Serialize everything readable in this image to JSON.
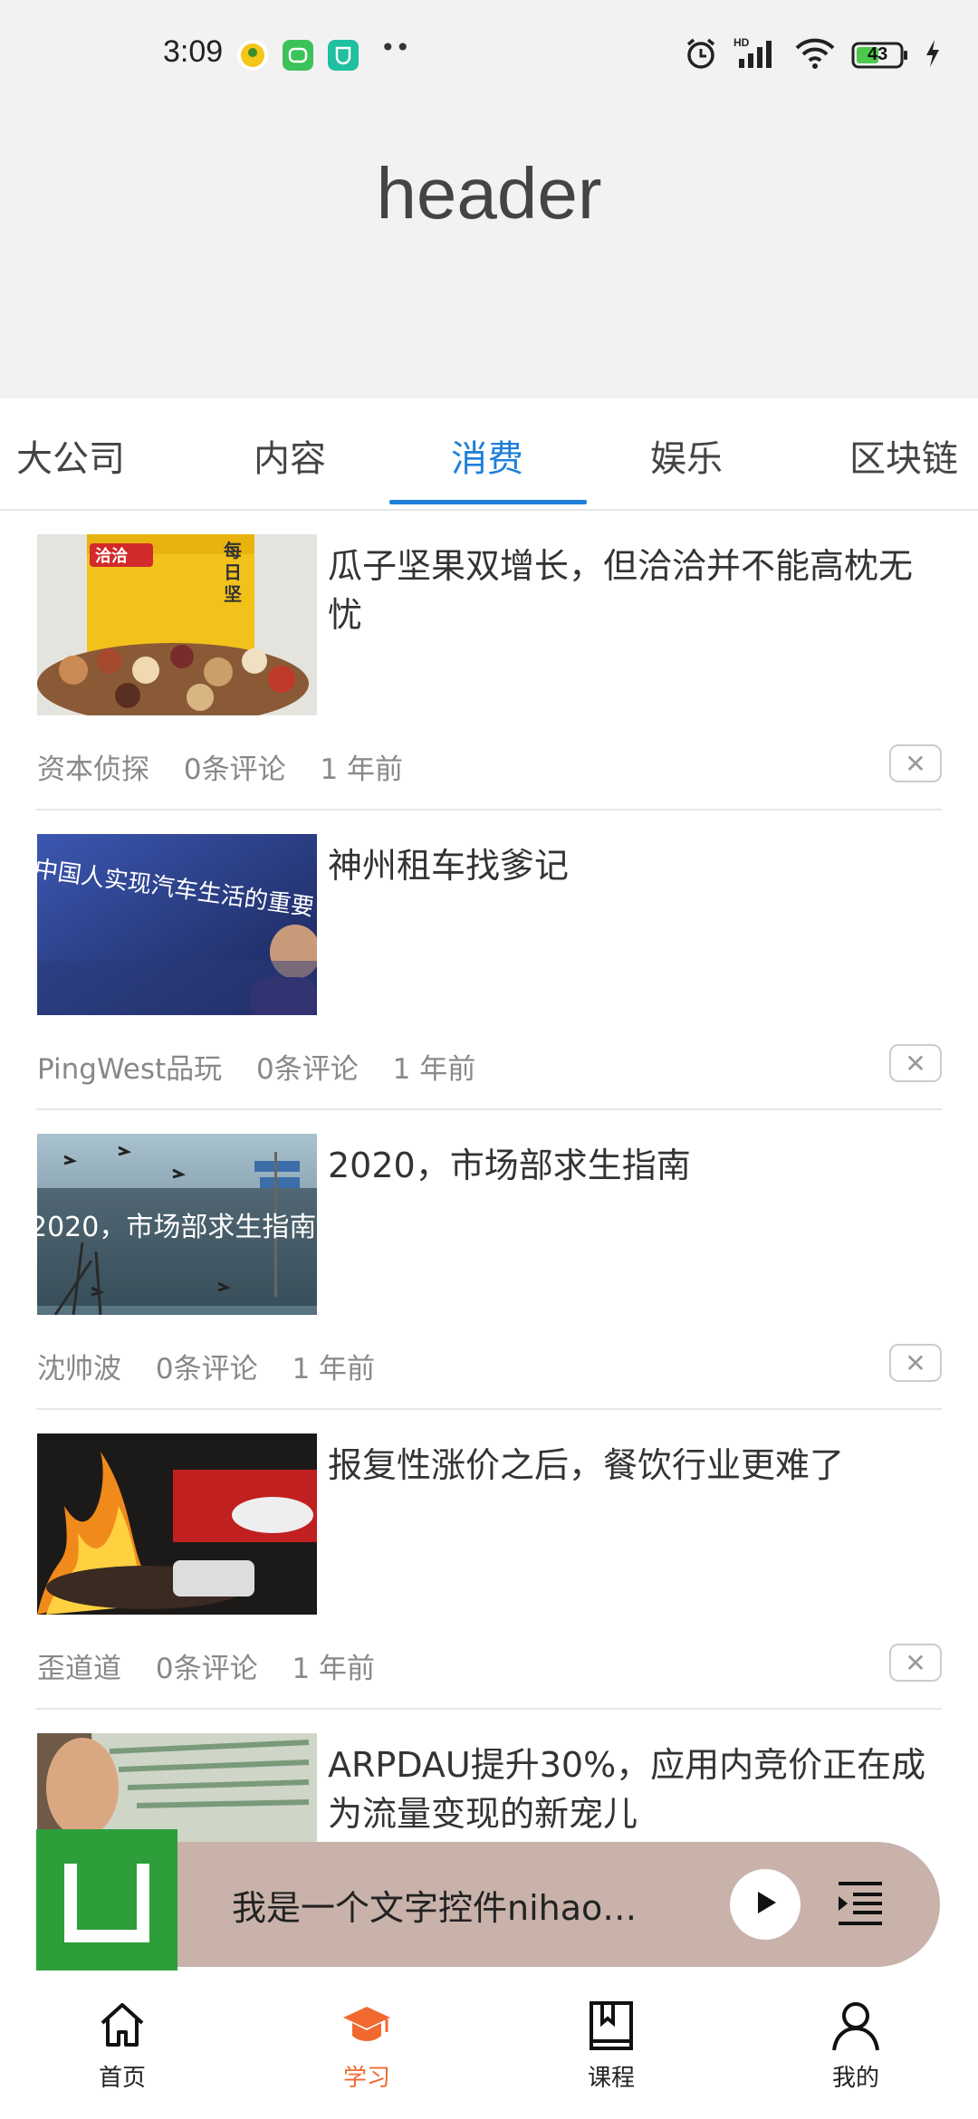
{
  "status_bar": {
    "time": "3:09",
    "battery": "43",
    "more": "••"
  },
  "header": {
    "title": "header"
  },
  "tabs": [
    {
      "label": "大公司"
    },
    {
      "label": "内容"
    },
    {
      "label": "消费",
      "active": true
    },
    {
      "label": "娱乐"
    },
    {
      "label": "区块链"
    }
  ],
  "feed": [
    {
      "title": "瓜子坚果双增长，但洽洽并不能高枕无忧",
      "source": "资本侦探",
      "comments": "0条评论",
      "time": "1 年前"
    },
    {
      "title": "神州租车找爹记",
      "source": "PingWest品玩",
      "comments": "0条评论",
      "time": "1 年前",
      "thumb_text": "中国人实现汽车生活的重要"
    },
    {
      "title": "2020，市场部求生指南",
      "source": "沈帅波",
      "comments": "0条评论",
      "time": "1 年前",
      "thumb_text": "2020，市场部求生指南"
    },
    {
      "title": "报复性涨价之后，餐饮行业更难了",
      "source": "歪道道",
      "comments": "0条评论",
      "time": "1 年前"
    },
    {
      "title": "ARPDAU提升30%，应用内竞价正在成为流量变现的新宠儿"
    }
  ],
  "thumb_brand": {
    "logo_text": "洽洽",
    "side_text": "每日坚"
  },
  "player": {
    "text": "我是一个文字控件nihao…"
  },
  "bottom_nav": [
    {
      "label": "首页",
      "icon": "home-icon"
    },
    {
      "label": "学习",
      "icon": "graduation-cap-icon",
      "active": true
    },
    {
      "label": "课程",
      "icon": "course-book-icon"
    },
    {
      "label": "我的",
      "icon": "person-icon"
    }
  ],
  "colors": {
    "accent": "#1e7fd8",
    "nav_active": "#f06a30",
    "player_bg": "#c8b2aa",
    "logo_green": "#2d9e3a"
  }
}
